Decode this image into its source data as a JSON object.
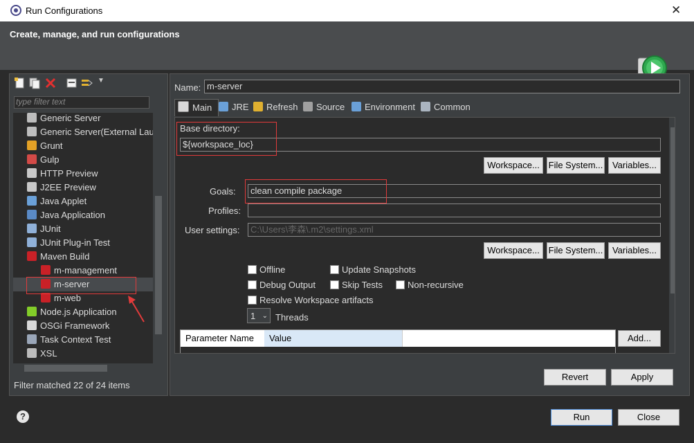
{
  "window": {
    "title": "Run Configurations",
    "close_glyph": "✕"
  },
  "header": {
    "title": "Create, manage, and run configurations",
    "run_icon": "run-icon"
  },
  "left": {
    "filter_placeholder": "type filter text",
    "tree": [
      {
        "label": "Generic Server",
        "icon": "server-icon",
        "indent": 1
      },
      {
        "label": "Generic Server(External Lau",
        "icon": "server-icon",
        "indent": 1
      },
      {
        "label": "Grunt",
        "icon": "grunt-icon",
        "indent": 1
      },
      {
        "label": "Gulp",
        "icon": "gulp-icon",
        "indent": 1
      },
      {
        "label": "HTTP Preview",
        "icon": "preview-icon",
        "indent": 1
      },
      {
        "label": "J2EE Preview",
        "icon": "preview-icon",
        "indent": 1
      },
      {
        "label": "Java Applet",
        "icon": "applet-icon",
        "indent": 1
      },
      {
        "label": "Java Application",
        "icon": "java-icon",
        "indent": 1
      },
      {
        "label": "JUnit",
        "icon": "junit-icon",
        "indent": 1
      },
      {
        "label": "JUnit Plug-in Test",
        "icon": "junit-icon",
        "indent": 1
      },
      {
        "label": "Maven Build",
        "icon": "maven-icon",
        "indent": 1,
        "expanded": true
      },
      {
        "label": "m-management",
        "icon": "maven-icon",
        "indent": 2
      },
      {
        "label": "m-server",
        "icon": "maven-icon",
        "indent": 2,
        "selected": true
      },
      {
        "label": "m-web",
        "icon": "maven-icon",
        "indent": 2
      },
      {
        "label": "Node.js Application",
        "icon": "nodejs-icon",
        "indent": 1
      },
      {
        "label": "OSGi Framework",
        "icon": "osgi-icon",
        "indent": 1
      },
      {
        "label": "Task Context Test",
        "icon": "task-icon",
        "indent": 1
      },
      {
        "label": "XSL",
        "icon": "xsl-icon",
        "indent": 1
      }
    ],
    "filter_status": "Filter matched 22 of 24 items"
  },
  "right": {
    "name_label": "Name:",
    "name_value": "m-server",
    "tabs": [
      {
        "label": "Main",
        "icon": "main-icon"
      },
      {
        "label": "JRE",
        "icon": "jre-icon"
      },
      {
        "label": "Refresh",
        "icon": "refresh-icon"
      },
      {
        "label": "Source",
        "icon": "source-icon"
      },
      {
        "label": "Environment",
        "icon": "environment-icon"
      },
      {
        "label": "Common",
        "icon": "common-icon"
      }
    ],
    "main": {
      "base_dir_label": "Base directory:",
      "base_dir_value": "${workspace_loc}",
      "btn_workspace": "Workspace...",
      "btn_filesystem": "File System...",
      "btn_variables": "Variables...",
      "goals_label": "Goals:",
      "goals_value": "clean compile package",
      "profiles_label": "Profiles:",
      "profiles_value": "",
      "user_settings_label": "User settings:",
      "user_settings_value": "C:\\Users\\李森\\.m2\\settings.xml",
      "options": {
        "offline": "Offline",
        "update_snapshots": "Update Snapshots",
        "debug_output": "Debug Output",
        "skip_tests": "Skip Tests",
        "non_recursive": "Non-recursive",
        "resolve_workspace": "Resolve Workspace artifacts"
      },
      "threads_value": "1",
      "threads_label": "Threads",
      "param_col_name": "Parameter Name",
      "param_col_value": "Value",
      "btn_add": "Add..."
    },
    "btn_revert": "Revert",
    "btn_apply": "Apply"
  },
  "footer": {
    "btn_run": "Run",
    "btn_close": "Close",
    "help_icon": "help-icon"
  }
}
